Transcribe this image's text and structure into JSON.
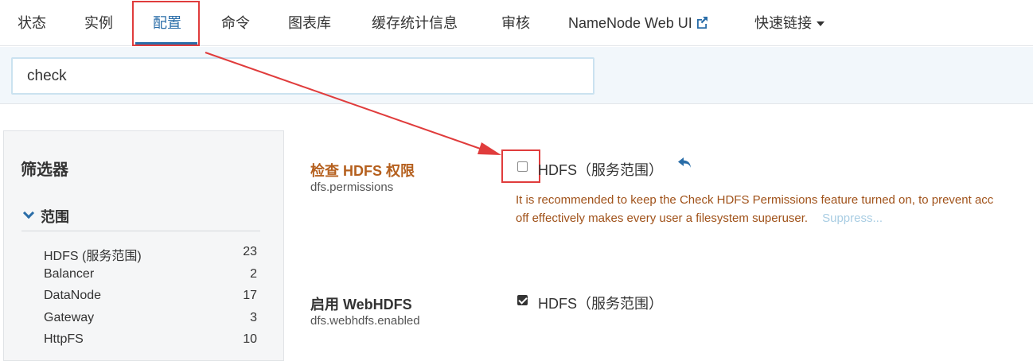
{
  "nav": {
    "tabs": [
      {
        "label": "状态"
      },
      {
        "label": "实例"
      },
      {
        "label": "配置"
      },
      {
        "label": "命令"
      },
      {
        "label": "图表库"
      },
      {
        "label": "缓存统计信息"
      },
      {
        "label": "审核"
      },
      {
        "label": "NameNode Web UI"
      },
      {
        "label": "快速链接"
      }
    ],
    "active_tab": "配置"
  },
  "search": {
    "value": "check"
  },
  "filters": {
    "title": "筛选器",
    "scope_title": "范围",
    "items": [
      {
        "label": "HDFS (服务范围)",
        "count": "23"
      },
      {
        "label": "Balancer",
        "count": "2"
      },
      {
        "label": "DataNode",
        "count": "17"
      },
      {
        "label": "Gateway",
        "count": "3"
      },
      {
        "label": "HttpFS",
        "count": "10"
      }
    ]
  },
  "configs": [
    {
      "label": "检查 HDFS 权限",
      "key": "dfs.permissions",
      "checked": false,
      "scope": "HDFS（服务范围）",
      "warning_line1": "It is recommended to keep the Check HDFS Permissions feature turned on, to prevent acc",
      "warning_line2": "off effectively makes every user a filesystem superuser.",
      "suppress": "Suppress..."
    },
    {
      "label": "启用 WebHDFS",
      "key": "dfs.webhdfs.enabled",
      "checked": true,
      "scope": "HDFS（服务范围）"
    }
  ],
  "colors": {
    "accent": "#2a6da8",
    "warning_label": "#b5601e",
    "annotation": "#e03c3c"
  },
  "icons": {
    "external_link": "external-link-icon",
    "undo": "undo-icon",
    "dropdown": "caret-down-icon"
  }
}
